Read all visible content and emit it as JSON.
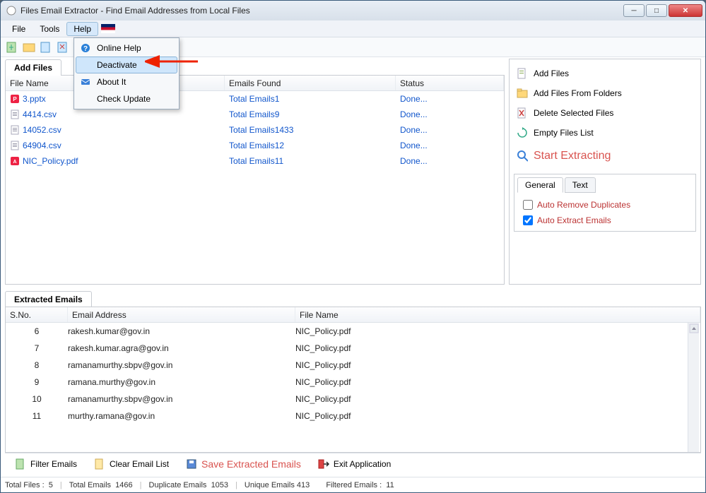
{
  "window": {
    "title": "Files Email Extractor -  Find Email Addresses from Local Files"
  },
  "menubar": {
    "file": "File",
    "tools": "Tools",
    "help": "Help"
  },
  "help_menu": {
    "online_help": "Online Help",
    "deactivate": "Deactivate",
    "about": "About It",
    "check_update": "Check Update"
  },
  "left_panel": {
    "tab": "Add Files",
    "headers": {
      "file_name": "File Name",
      "emails_found": "Emails Found",
      "status": "Status"
    },
    "rows": [
      {
        "icon": "pptx",
        "name": "3.pptx",
        "emails": "Total Emails1",
        "status": "Done..."
      },
      {
        "icon": "csv",
        "name": "4414.csv",
        "emails": "Total Emails9",
        "status": "Done..."
      },
      {
        "icon": "csv",
        "name": "14052.csv",
        "emails": "Total Emails1433",
        "status": "Done..."
      },
      {
        "icon": "csv",
        "name": "64904.csv",
        "emails": "Total Emails12",
        "status": "Done..."
      },
      {
        "icon": "pdf",
        "name": "NIC_Policy.pdf",
        "emails": "Total Emails11",
        "status": "Done..."
      }
    ]
  },
  "side": {
    "add_files": "Add Files",
    "add_folders": "Add Files From Folders",
    "delete_selected": "Delete Selected Files",
    "empty": "Empty Files List",
    "start": "Start Extracting",
    "tabs": {
      "general": "General",
      "text": "Text"
    },
    "opt_dup": "Auto Remove Duplicates",
    "opt_ext": "Auto Extract Emails"
  },
  "extracted": {
    "tab": "Extracted Emails",
    "headers": {
      "sno": "S.No.",
      "email": "Email Address",
      "file": "File Name"
    },
    "rows": [
      {
        "sno": "6",
        "email": "rakesh.kumar@gov.in",
        "file": "NIC_Policy.pdf"
      },
      {
        "sno": "7",
        "email": "rakesh.kumar.agra@gov.in",
        "file": "NIC_Policy.pdf"
      },
      {
        "sno": "8",
        "email": "ramanamurthy.sbpv@gov.in",
        "file": "NIC_Policy.pdf"
      },
      {
        "sno": "9",
        "email": "ramana.murthy@gov.in",
        "file": "NIC_Policy.pdf"
      },
      {
        "sno": "10",
        "email": "ramanamurthy.sbpv@gov.in",
        "file": "NIC_Policy.pdf"
      },
      {
        "sno": "11",
        "email": "murthy.ramana@gov.in",
        "file": "NIC_Policy.pdf"
      }
    ]
  },
  "bottombar": {
    "filter": "Filter Emails",
    "clear": "Clear Email List",
    "save": "Save Extracted Emails",
    "exit": "Exit Application"
  },
  "status": {
    "total_files_label": "Total Files :",
    "total_files": "5",
    "total_emails_label": "Total Emails",
    "total_emails": "1466",
    "dup_label": "Duplicate Emails",
    "dup": "1053",
    "unique_label": "Unique Emails",
    "unique": "413",
    "filtered_label": "Filtered Emails :",
    "filtered": "11"
  },
  "icons": {
    "help": "?",
    "mail": "✉",
    "search": "🔍",
    "add": "📄",
    "folder": "📁",
    "delete": "🗑",
    "refresh": "♻",
    "exit": "↪"
  }
}
